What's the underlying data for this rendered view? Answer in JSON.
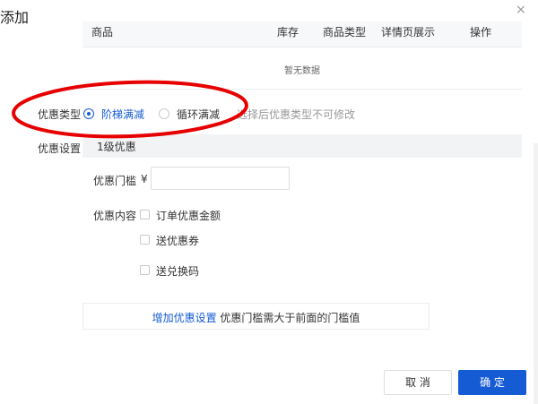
{
  "dialog": {
    "title": "添加",
    "close_glyph": "×"
  },
  "product_table": {
    "columns": [
      "商品",
      "库存",
      "商品类型",
      "详情页展示",
      "操作"
    ],
    "empty_text": "暂无数据"
  },
  "discount_type": {
    "label": "优惠类型",
    "options": [
      {
        "label": "阶梯满减",
        "checked": true
      },
      {
        "label": "循环满减",
        "checked": false
      }
    ],
    "hint": "选择后优惠类型不可修改"
  },
  "discount_settings": {
    "label": "优惠设置",
    "level_title": "1级优惠",
    "threshold_label": "优惠门槛",
    "currency_symbol": "¥",
    "threshold_value": "",
    "content_label": "优惠内容",
    "content_options": [
      {
        "label": "订单优惠金额",
        "checked": false
      },
      {
        "label": "送优惠券",
        "checked": false
      },
      {
        "label": "送兑换码",
        "checked": false
      }
    ],
    "add_link": "增加优惠设置",
    "add_hint": "优惠门槛需大于前面的门槛值"
  },
  "footer": {
    "cancel_label": "取 消",
    "ok_label": "确 定"
  },
  "colors": {
    "accent": "#155bd4",
    "annotation_ellipse": "#e60000"
  }
}
